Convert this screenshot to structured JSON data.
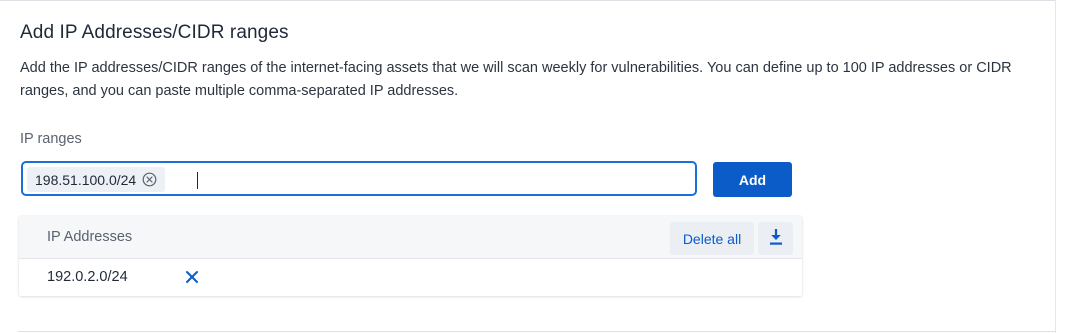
{
  "section": {
    "title": "Add IP Addresses/CIDR ranges",
    "description": "Add the IP addresses/CIDR ranges of the internet-facing assets that we will scan weekly for vulnerabilities. You can define up to 100 IP addresses or CIDR ranges, and you can paste multiple comma-separated IP addresses."
  },
  "ip_input": {
    "label": "IP ranges",
    "chips": [
      {
        "value": "198.51.100.0/24",
        "icon": "circle-x-icon"
      }
    ],
    "current_text": ""
  },
  "add_button": {
    "label": "Add"
  },
  "table": {
    "column_header": "IP Addresses",
    "delete_all_label": "Delete all",
    "download_icon": "download-icon",
    "rows": [
      {
        "ip": "192.0.2.0/24",
        "remove_icon": "x-icon"
      }
    ]
  },
  "colors": {
    "accent": "#0b5cc9",
    "focus_border": "#1b6fd6"
  }
}
